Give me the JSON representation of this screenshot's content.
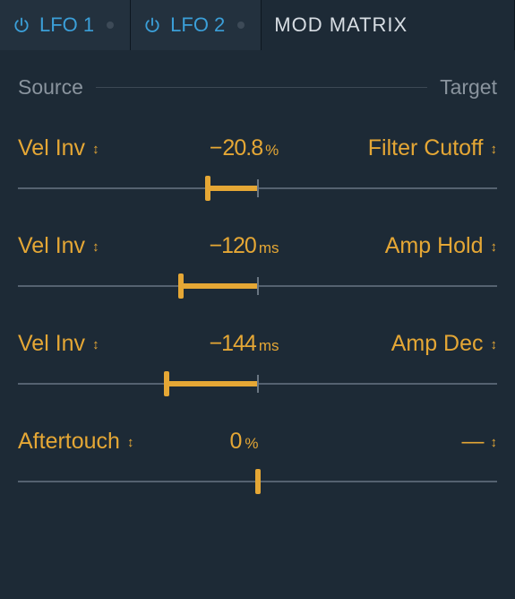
{
  "tabs": {
    "lfo1": {
      "label": "LFO 1"
    },
    "lfo2": {
      "label": "LFO 2"
    },
    "matrix": {
      "label": "MOD MATRIX"
    }
  },
  "header": {
    "source": "Source",
    "target": "Target"
  },
  "glyphs": {
    "caret": "↕",
    "dash": "—"
  },
  "rows": [
    {
      "source": "Vel Inv",
      "value_num": "− 20.8",
      "value_unit": "%",
      "target": "Filter Cutoff",
      "handle_pct": 39.6,
      "fill_left_pct": 39.6,
      "fill_right_pct": 50
    },
    {
      "source": "Vel Inv",
      "value_num": "−120",
      "value_unit": "ms",
      "target": "Amp Hold",
      "handle_pct": 34,
      "fill_left_pct": 34,
      "fill_right_pct": 50
    },
    {
      "source": "Vel Inv",
      "value_num": "−144",
      "value_unit": "ms",
      "target": "Amp Dec",
      "handle_pct": 31,
      "fill_left_pct": 31,
      "fill_right_pct": 50
    },
    {
      "source": "Aftertouch",
      "value_num": "0",
      "value_unit": "%",
      "target": "—",
      "target_is_dash": true,
      "handle_pct": 50,
      "fill_left_pct": 50,
      "fill_right_pct": 50
    }
  ]
}
